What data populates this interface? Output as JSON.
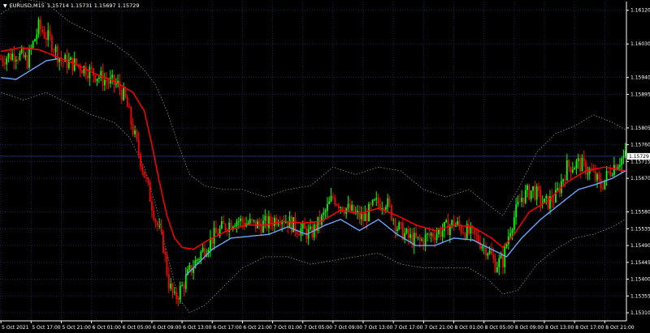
{
  "header": {
    "symbol": "EURUSD,M15",
    "quotes": "1.15714 1.15731 1.15697 1.15729"
  },
  "colors": {
    "background": "#000000",
    "grid": "#1b2550",
    "bull": "#00ff00",
    "bear": "#ff0000",
    "ma_red": "#ff0000",
    "ma_blue": "#6ea6ff",
    "band": "#8a8a8a",
    "axis_text": "#ffffff",
    "current_price_bg": "#ffffff"
  },
  "chart_data": {
    "type": "candlestick",
    "current_price": "1.15729",
    "ylim": [
      1.1531,
      1.16165
    ],
    "y_ticks": [
      {
        "label": "1.16120",
        "value": 1.1612
      },
      {
        "label": "1.16030",
        "value": 1.1603
      },
      {
        "label": "1.15940",
        "value": 1.1594
      },
      {
        "label": "1.15895",
        "value": 1.15895
      },
      {
        "label": "1.15805",
        "value": 1.15805
      },
      {
        "label": "1.15760",
        "value": 1.1576
      },
      {
        "label": "1.15715",
        "value": 1.15715
      },
      {
        "label": "1.15670",
        "value": 1.1567
      },
      {
        "label": "1.15580",
        "value": 1.1558
      },
      {
        "label": "1.15535",
        "value": 1.15535
      },
      {
        "label": "1.15490",
        "value": 1.1549
      },
      {
        "label": "1.15445",
        "value": 1.15445
      },
      {
        "label": "1.15400",
        "value": 1.154
      },
      {
        "label": "1.15355",
        "value": 1.15355
      },
      {
        "label": "1.15310",
        "value": 1.1531
      }
    ],
    "x_ticks": [
      {
        "label": "5 Oct 2021",
        "bar": 0
      },
      {
        "label": "5 Oct 17:00",
        "bar": 16
      },
      {
        "label": "5 Oct 21:00",
        "bar": 32
      },
      {
        "label": "6 Oct 01:00",
        "bar": 48
      },
      {
        "label": "6 Oct 05:00",
        "bar": 64
      },
      {
        "label": "6 Oct 09:00",
        "bar": 80
      },
      {
        "label": "6 Oct 13:00",
        "bar": 96
      },
      {
        "label": "6 Oct 17:00",
        "bar": 112
      },
      {
        "label": "6 Oct 21:00",
        "bar": 128
      },
      {
        "label": "7 Oct 01:00",
        "bar": 144
      },
      {
        "label": "7 Oct 05:00",
        "bar": 160
      },
      {
        "label": "7 Oct 09:00",
        "bar": 176
      },
      {
        "label": "7 Oct 13:00",
        "bar": 192
      },
      {
        "label": "7 Oct 17:00",
        "bar": 208
      },
      {
        "label": "7 Oct 21:00",
        "bar": 224
      },
      {
        "label": "8 Oct 01:00",
        "bar": 240
      },
      {
        "label": "8 Oct 05:00",
        "bar": 256
      },
      {
        "label": "8 Oct 09:00",
        "bar": 272
      },
      {
        "label": "8 Oct 13:00",
        "bar": 288
      },
      {
        "label": "8 Oct 17:00",
        "bar": 304
      },
      {
        "label": "8 Oct 21:00",
        "bar": 320
      }
    ],
    "bar_count": 332,
    "closes_anchor": [
      [
        0,
        1.1599
      ],
      [
        8,
        1.16005
      ],
      [
        14,
        1.15985
      ],
      [
        20,
        1.16075
      ],
      [
        26,
        1.1604
      ],
      [
        32,
        1.15985
      ],
      [
        40,
        1.15975
      ],
      [
        48,
        1.15955
      ],
      [
        56,
        1.1593
      ],
      [
        62,
        1.1592
      ],
      [
        66,
        1.1588
      ],
      [
        70,
        1.158
      ],
      [
        74,
        1.1572
      ],
      [
        78,
        1.1564
      ],
      [
        82,
        1.1556
      ],
      [
        86,
        1.1549
      ],
      [
        89,
        1.1539
      ],
      [
        92,
        1.15345
      ],
      [
        96,
        1.1538
      ],
      [
        100,
        1.1542
      ],
      [
        106,
        1.1547
      ],
      [
        112,
        1.1551
      ],
      [
        118,
        1.1554
      ],
      [
        124,
        1.1556
      ],
      [
        130,
        1.1555
      ],
      [
        136,
        1.15545
      ],
      [
        142,
        1.1555
      ],
      [
        148,
        1.1557
      ],
      [
        156,
        1.1554
      ],
      [
        164,
        1.1552
      ],
      [
        170,
        1.1556
      ],
      [
        176,
        1.1562
      ],
      [
        180,
        1.156
      ],
      [
        186,
        1.1558
      ],
      [
        192,
        1.1556
      ],
      [
        198,
        1.156
      ],
      [
        204,
        1.1561
      ],
      [
        210,
        1.1554
      ],
      [
        216,
        1.1551
      ],
      [
        222,
        1.155
      ],
      [
        228,
        1.1552
      ],
      [
        234,
        1.1553
      ],
      [
        240,
        1.1555
      ],
      [
        246,
        1.1553
      ],
      [
        252,
        1.1551
      ],
      [
        258,
        1.1548
      ],
      [
        262,
        1.1544
      ],
      [
        266,
        1.1545
      ],
      [
        270,
        1.1554
      ],
      [
        276,
        1.1562
      ],
      [
        282,
        1.1564
      ],
      [
        288,
        1.156
      ],
      [
        294,
        1.1562
      ],
      [
        300,
        1.157
      ],
      [
        306,
        1.1571
      ],
      [
        312,
        1.1569
      ],
      [
        318,
        1.1565
      ],
      [
        324,
        1.157
      ],
      [
        328,
        1.1572
      ],
      [
        331,
        1.15729
      ]
    ],
    "ma_red_anchor": [
      [
        0,
        1.1601
      ],
      [
        10,
        1.1602
      ],
      [
        20,
        1.16015
      ],
      [
        30,
        1.15995
      ],
      [
        40,
        1.15975
      ],
      [
        50,
        1.1595
      ],
      [
        60,
        1.1593
      ],
      [
        70,
        1.159
      ],
      [
        76,
        1.1585
      ],
      [
        80,
        1.1576
      ],
      [
        84,
        1.1566
      ],
      [
        88,
        1.1557
      ],
      [
        92,
        1.1551
      ],
      [
        96,
        1.15485
      ],
      [
        102,
        1.1548
      ],
      [
        110,
        1.15505
      ],
      [
        120,
        1.1553
      ],
      [
        130,
        1.15545
      ],
      [
        140,
        1.15545
      ],
      [
        150,
        1.15555
      ],
      [
        160,
        1.1555
      ],
      [
        170,
        1.15555
      ],
      [
        180,
        1.15585
      ],
      [
        190,
        1.15575
      ],
      [
        200,
        1.1559
      ],
      [
        210,
        1.1557
      ],
      [
        220,
        1.15545
      ],
      [
        230,
        1.1553
      ],
      [
        240,
        1.15545
      ],
      [
        250,
        1.1554
      ],
      [
        260,
        1.1551
      ],
      [
        266,
        1.15485
      ],
      [
        272,
        1.1552
      ],
      [
        280,
        1.1558
      ],
      [
        290,
        1.1561
      ],
      [
        300,
        1.1566
      ],
      [
        310,
        1.1569
      ],
      [
        320,
        1.157
      ],
      [
        331,
        1.1569
      ]
    ],
    "ma_blue_anchor": [
      [
        0,
        1.1594
      ],
      [
        8,
        1.15935
      ],
      [
        16,
        1.1596
      ],
      [
        24,
        1.15985
      ],
      [
        30,
        1.1599
      ]
    ],
    "ma_blue_anchor_2": [
      [
        98,
        1.1541
      ],
      [
        104,
        1.1544
      ],
      [
        112,
        1.1548
      ],
      [
        122,
        1.1551
      ],
      [
        132,
        1.15515
      ],
      [
        142,
        1.1552
      ],
      [
        152,
        1.1554
      ],
      [
        162,
        1.1552
      ],
      [
        172,
        1.15545
      ],
      [
        180,
        1.1556
      ],
      [
        190,
        1.1553
      ],
      [
        200,
        1.1556
      ],
      [
        210,
        1.1552
      ],
      [
        220,
        1.1549
      ],
      [
        230,
        1.1549
      ],
      [
        240,
        1.1551
      ],
      [
        250,
        1.15505
      ],
      [
        260,
        1.1548
      ],
      [
        268,
        1.1546
      ],
      [
        276,
        1.1551
      ],
      [
        286,
        1.1556
      ],
      [
        296,
        1.156
      ],
      [
        306,
        1.1564
      ],
      [
        316,
        1.15655
      ],
      [
        324,
        1.1567
      ],
      [
        331,
        1.1569
      ]
    ],
    "band_upper_anchor": [
      [
        0,
        1.1611
      ],
      [
        12,
        1.1615
      ],
      [
        24,
        1.1614
      ],
      [
        36,
        1.1609
      ],
      [
        48,
        1.1606
      ],
      [
        60,
        1.1603
      ],
      [
        68,
        1.16
      ],
      [
        76,
        1.1596
      ],
      [
        82,
        1.1592
      ],
      [
        88,
        1.1585
      ],
      [
        94,
        1.1576
      ],
      [
        100,
        1.1568
      ],
      [
        108,
        1.1565
      ],
      [
        118,
        1.1564
      ],
      [
        128,
        1.1564
      ],
      [
        140,
        1.1562
      ],
      [
        152,
        1.1564
      ],
      [
        164,
        1.1565
      ],
      [
        176,
        1.157
      ],
      [
        188,
        1.1568
      ],
      [
        200,
        1.157
      ],
      [
        212,
        1.1569
      ],
      [
        224,
        1.1564
      ],
      [
        236,
        1.1562
      ],
      [
        248,
        1.1564
      ],
      [
        258,
        1.156
      ],
      [
        266,
        1.1557
      ],
      [
        274,
        1.1564
      ],
      [
        284,
        1.1574
      ],
      [
        294,
        1.1579
      ],
      [
        304,
        1.1581
      ],
      [
        314,
        1.1584
      ],
      [
        324,
        1.1582
      ],
      [
        331,
        1.158
      ]
    ],
    "band_lower_anchor": [
      [
        0,
        1.159
      ],
      [
        12,
        1.1588
      ],
      [
        24,
        1.159
      ],
      [
        36,
        1.1587
      ],
      [
        48,
        1.1584
      ],
      [
        60,
        1.1582
      ],
      [
        68,
        1.1578
      ],
      [
        76,
        1.157
      ],
      [
        82,
        1.156
      ],
      [
        88,
        1.1547
      ],
      [
        94,
        1.1535
      ],
      [
        100,
        1.1531
      ],
      [
        108,
        1.1533
      ],
      [
        118,
        1.1538
      ],
      [
        128,
        1.1543
      ],
      [
        140,
        1.1546
      ],
      [
        152,
        1.1546
      ],
      [
        164,
        1.1544
      ],
      [
        176,
        1.1545
      ],
      [
        188,
        1.1546
      ],
      [
        200,
        1.1547
      ],
      [
        212,
        1.1544
      ],
      [
        224,
        1.1543
      ],
      [
        236,
        1.1543
      ],
      [
        248,
        1.1543
      ],
      [
        258,
        1.154
      ],
      [
        266,
        1.1536
      ],
      [
        274,
        1.1537
      ],
      [
        284,
        1.1544
      ],
      [
        294,
        1.1548
      ],
      [
        304,
        1.1551
      ],
      [
        314,
        1.1552
      ],
      [
        324,
        1.1554
      ],
      [
        331,
        1.1556
      ]
    ]
  }
}
